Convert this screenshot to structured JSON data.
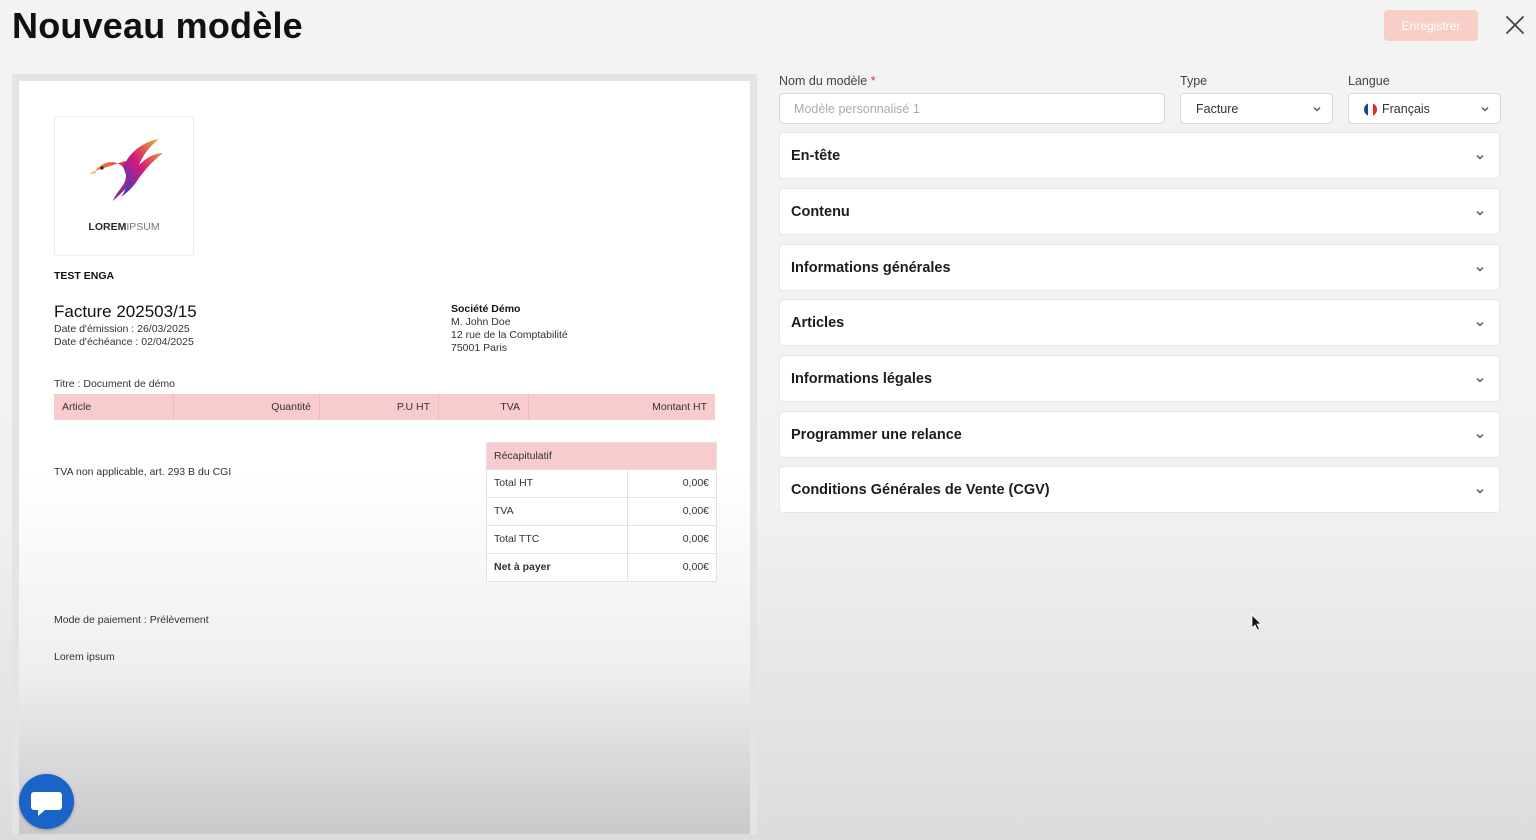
{
  "header": {
    "title": "Nouveau modèle",
    "save_label": "Enregistrer",
    "close_icon": "close-icon"
  },
  "colors": {
    "accent_pink": "#f8ccce",
    "save_disabled": "#f7cfc6",
    "chat_blue": "#1a63c7"
  },
  "preview": {
    "logo": {
      "brand": "LOREM",
      "brand_light": "IPSUM"
    },
    "company": "TEST ENGA",
    "document_title": "Facture 202503/15",
    "issue_date": "Date d'émission : 26/03/2025",
    "due_date": "Date d'échéance : 02/04/2025",
    "client": {
      "name": "Société Démo",
      "contact": "M. John Doe",
      "address": "12 rue de la Comptabilité",
      "city": "75001 Paris"
    },
    "subject": "Titre : Document de démo",
    "table_headers": [
      "Article",
      "Quantité",
      "P.U HT",
      "TVA",
      "Montant HT"
    ],
    "vat_note": "TVA non applicable, art. 293 B du CGI",
    "recap": {
      "title": "Récapitulatif",
      "rows": [
        {
          "label": "Total HT",
          "value": "0,00€"
        },
        {
          "label": "TVA",
          "value": "0,00€"
        },
        {
          "label": "Total TTC",
          "value": "0,00€"
        },
        {
          "label": "Net à payer",
          "value": "0,00€"
        }
      ]
    },
    "payment_mode": "Mode de paiement : Prélèvement",
    "footer_text": "Lorem ipsum"
  },
  "form": {
    "name_label": "Nom du modèle",
    "required_mark": "*",
    "name_placeholder": "Modèle personnalisé 1",
    "name_value": "",
    "type_label": "Type",
    "type_value": "Facture",
    "language_label": "Langue",
    "language_value": "Français",
    "sections": [
      "En-tête",
      "Contenu",
      "Informations générales",
      "Articles",
      "Informations légales",
      "Programmer une relance",
      "Conditions Générales de Vente (CGV)"
    ]
  }
}
